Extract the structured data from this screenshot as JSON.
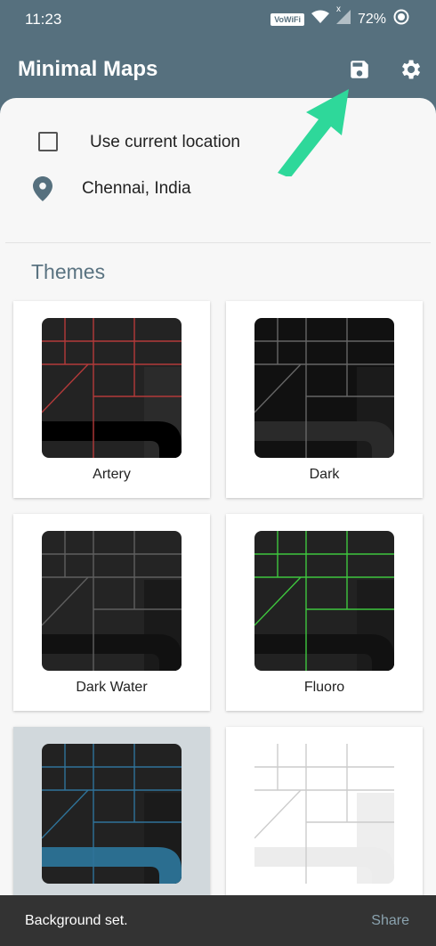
{
  "status_bar": {
    "time": "11:23",
    "network_badge": "VoWiFi",
    "signal_mark": "x",
    "battery": "72%"
  },
  "app": {
    "title": "Minimal Maps",
    "save_icon": "save-icon",
    "settings_icon": "gear-icon"
  },
  "location": {
    "checkbox_label": "Use current location",
    "checked": false,
    "city": "Chennai, India"
  },
  "themes": {
    "heading": "Themes",
    "items": [
      {
        "name": "Artery",
        "bg": "#232323",
        "road": "#000000",
        "line": "#b33a3a",
        "block": "#2b2b2b",
        "selected": false
      },
      {
        "name": "Dark",
        "bg": "#111111",
        "road": "#2a2a2a",
        "line": "#666666",
        "block": "#1b1b1b",
        "selected": false
      },
      {
        "name": "Dark Water",
        "bg": "#242424",
        "road": "#111111",
        "line": "#5f5f5f",
        "block": "#1a1a1a",
        "selected": false
      },
      {
        "name": "Fluoro",
        "bg": "#222222",
        "road": "#111111",
        "line": "#3ec63e",
        "block": "#1b1b1b",
        "selected": false
      },
      {
        "name": "",
        "bg": "#222222",
        "road": "#2b6e90",
        "line": "#2f7399",
        "block": "#1b1b1b",
        "selected": true
      },
      {
        "name": "",
        "bg": "#ffffff",
        "road": "#ececec",
        "line": "#cccccc",
        "block": "#eeeeee",
        "selected": false
      }
    ]
  },
  "snackbar": {
    "message": "Background set.",
    "action": "Share"
  },
  "colors": {
    "primary": "#56707e",
    "arrow": "#2ed89a"
  }
}
